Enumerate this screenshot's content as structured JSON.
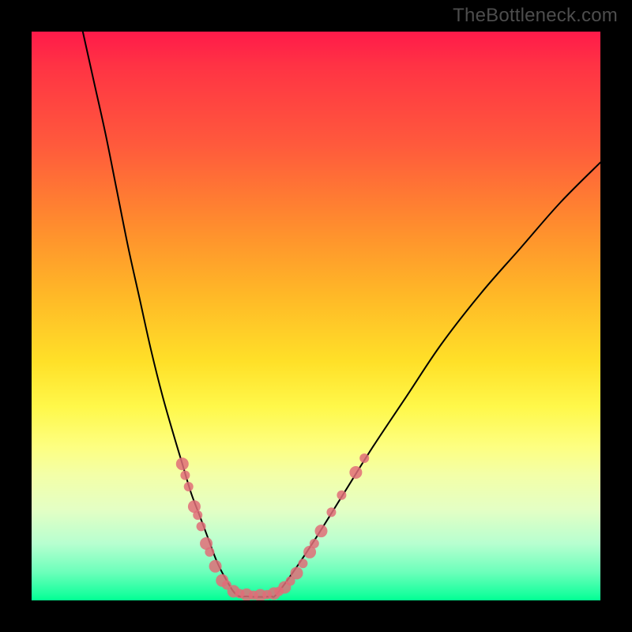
{
  "watermark": "TheBottleneck.com",
  "chart_data": {
    "type": "line",
    "title": "",
    "xlabel": "",
    "ylabel": "",
    "xlim": [
      0,
      100
    ],
    "ylim": [
      0,
      100
    ],
    "grid": false,
    "legend": false,
    "background_gradient": {
      "direction": "vertical",
      "stops": [
        {
          "pos": 0.0,
          "color": "#ff1a4a"
        },
        {
          "pos": 0.2,
          "color": "#ff5a3c"
        },
        {
          "pos": 0.46,
          "color": "#ffb727"
        },
        {
          "pos": 0.66,
          "color": "#fff84a"
        },
        {
          "pos": 0.84,
          "color": "#e4ffc4"
        },
        {
          "pos": 0.95,
          "color": "#6dffbb"
        },
        {
          "pos": 1.0,
          "color": "#00ff92"
        }
      ]
    },
    "note": "Axes are unlabeled in the image; x and y are normalized 0-100 by plot-area width/height. y=100 at top, y=0 at bottom.",
    "series": [
      {
        "name": "left-branch",
        "stroke": "#000000",
        "stroke_width": 2,
        "x": [
          9,
          11,
          13,
          15,
          17,
          19,
          21,
          23,
          25,
          26.5,
          28,
          29.5,
          31,
          32.5,
          34,
          36
        ],
        "y": [
          100,
          91,
          82,
          72,
          62,
          53,
          44,
          36,
          29,
          24,
          19,
          15,
          11,
          7,
          4,
          1
        ]
      },
      {
        "name": "valley-floor",
        "stroke": "#000000",
        "stroke_width": 2,
        "x": [
          36,
          38,
          40,
          42,
          43
        ],
        "y": [
          1,
          0.7,
          0.6,
          0.7,
          1
        ]
      },
      {
        "name": "right-branch",
        "stroke": "#000000",
        "stroke_width": 2,
        "x": [
          43,
          46,
          50,
          55,
          60,
          66,
          72,
          79,
          86,
          93,
          100
        ],
        "y": [
          1,
          5,
          11,
          19,
          27,
          36,
          45,
          54,
          62,
          70,
          77
        ]
      }
    ],
    "markers": {
      "name": "highlighted-points",
      "fill": "#e06d78",
      "opacity": 0.85,
      "r_small": 5,
      "r_large": 8,
      "points": [
        {
          "x": 26.5,
          "y": 24,
          "r": 8
        },
        {
          "x": 27.0,
          "y": 22,
          "r": 6
        },
        {
          "x": 27.6,
          "y": 20,
          "r": 6
        },
        {
          "x": 28.6,
          "y": 16.5,
          "r": 8
        },
        {
          "x": 29.2,
          "y": 15,
          "r": 6
        },
        {
          "x": 29.8,
          "y": 13,
          "r": 6
        },
        {
          "x": 30.7,
          "y": 10,
          "r": 8
        },
        {
          "x": 31.3,
          "y": 8.5,
          "r": 6
        },
        {
          "x": 32.3,
          "y": 6,
          "r": 8
        },
        {
          "x": 33.5,
          "y": 3.5,
          "r": 8
        },
        {
          "x": 34.3,
          "y": 2.7,
          "r": 6
        },
        {
          "x": 35.5,
          "y": 1.6,
          "r": 8
        },
        {
          "x": 36.6,
          "y": 1.2,
          "r": 6
        },
        {
          "x": 37.8,
          "y": 1.0,
          "r": 8
        },
        {
          "x": 39.0,
          "y": 0.9,
          "r": 6
        },
        {
          "x": 40.2,
          "y": 0.9,
          "r": 8
        },
        {
          "x": 41.4,
          "y": 1.0,
          "r": 6
        },
        {
          "x": 42.6,
          "y": 1.2,
          "r": 8
        },
        {
          "x": 43.5,
          "y": 1.6,
          "r": 6
        },
        {
          "x": 44.5,
          "y": 2.3,
          "r": 8
        },
        {
          "x": 45.5,
          "y": 3.4,
          "r": 6
        },
        {
          "x": 46.6,
          "y": 4.8,
          "r": 8
        },
        {
          "x": 47.7,
          "y": 6.5,
          "r": 6
        },
        {
          "x": 48.9,
          "y": 8.5,
          "r": 8
        },
        {
          "x": 49.7,
          "y": 10.0,
          "r": 6
        },
        {
          "x": 50.9,
          "y": 12.2,
          "r": 8
        },
        {
          "x": 52.7,
          "y": 15.5,
          "r": 6
        },
        {
          "x": 54.5,
          "y": 18.5,
          "r": 6
        },
        {
          "x": 57.0,
          "y": 22.5,
          "r": 8
        },
        {
          "x": 58.5,
          "y": 25.0,
          "r": 6
        }
      ]
    }
  }
}
